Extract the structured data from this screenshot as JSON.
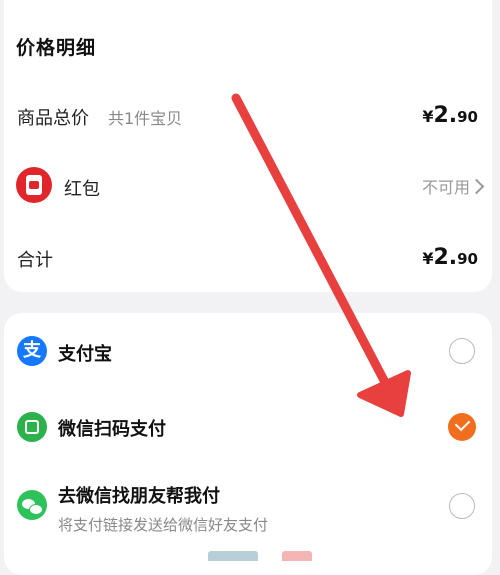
{
  "price_detail": {
    "title": "价格明细",
    "goods_total": {
      "label": "商品总价",
      "sub": "共1件宝贝",
      "currency": "¥",
      "price_int": "2.",
      "price_dec": "90"
    },
    "red_packet": {
      "label": "红包",
      "status": "不可用",
      "icon": "red-packet-icon"
    },
    "total": {
      "label": "合计",
      "currency": "¥",
      "price_int": "2.",
      "price_dec": "90"
    }
  },
  "payment_methods": [
    {
      "label": "支付宝",
      "icon": "alipay-icon",
      "selected": false
    },
    {
      "label": "微信扫码支付",
      "icon": "wechat-scan-icon",
      "selected": true
    },
    {
      "label": "去微信找朋友帮我付",
      "sub": "将支付链接发送给微信好友支付",
      "icon": "wechat-friend-icon",
      "selected": false
    }
  ],
  "colors": {
    "accent": "#f06e1d",
    "red_packet": "#e0262b",
    "alipay": "#1677ff",
    "wechat": "#2bb24c",
    "annotation_arrow": "#e8403f"
  }
}
